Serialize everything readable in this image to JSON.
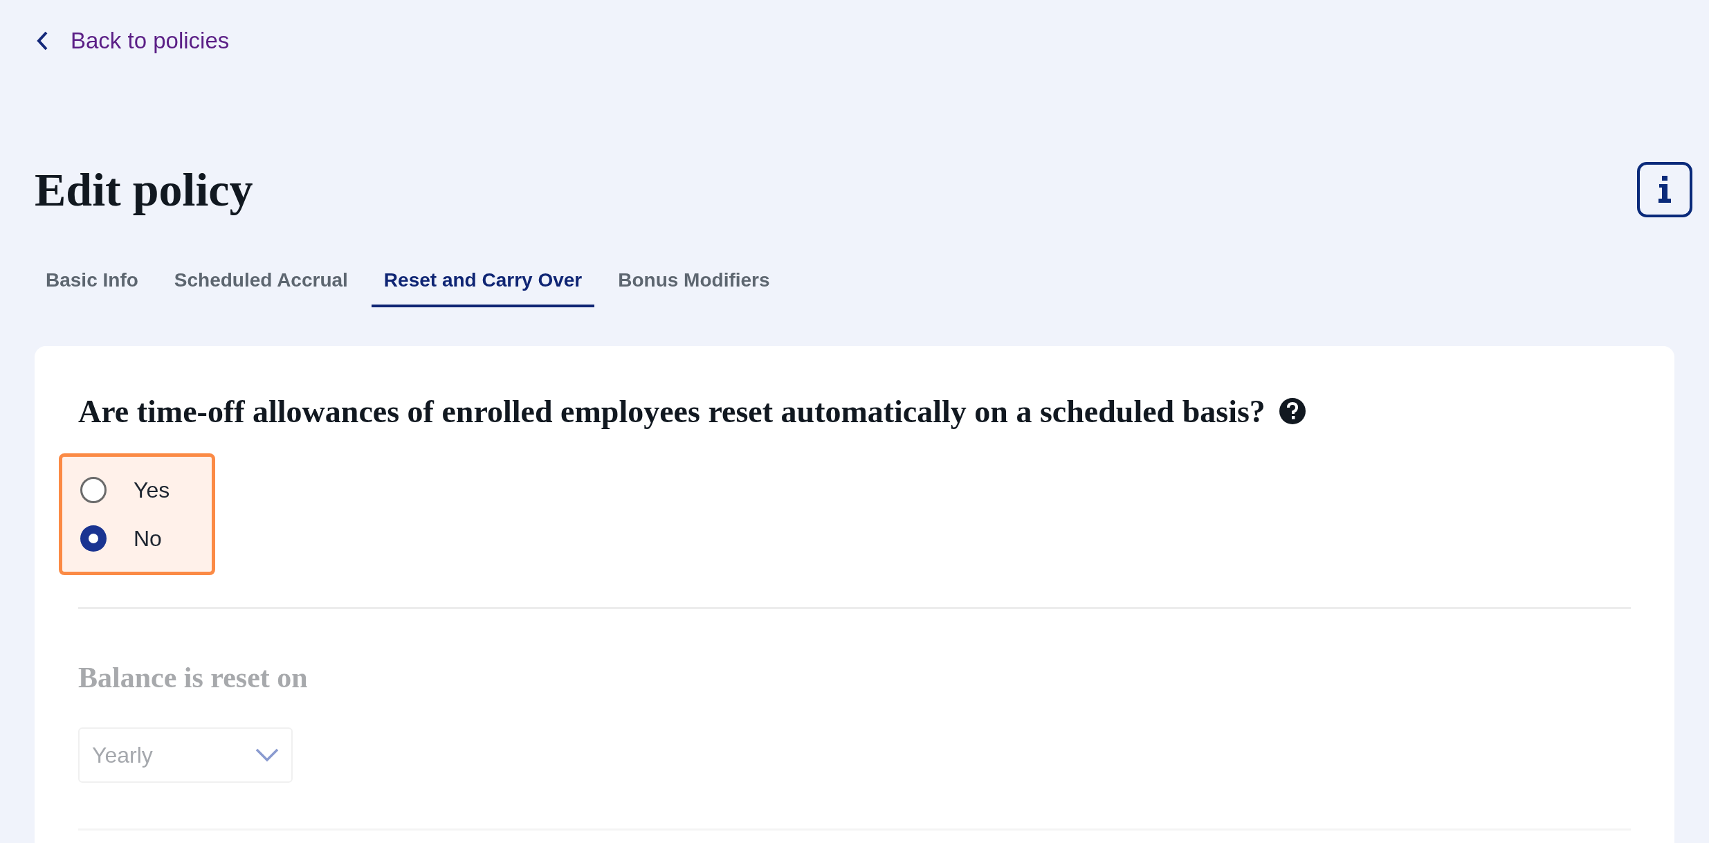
{
  "back_link": {
    "label": "Back to policies"
  },
  "page_title": "Edit policy",
  "tabs": [
    {
      "label": "Basic Info",
      "selected": false
    },
    {
      "label": "Scheduled Accrual",
      "selected": false
    },
    {
      "label": "Reset and Carry Over",
      "selected": true
    },
    {
      "label": "Bonus Modifiers",
      "selected": false
    }
  ],
  "reset_question": {
    "label": "Are time-off allowances of enrolled employees reset automatically on a scheduled basis?",
    "highlighted": true,
    "options": [
      {
        "label": "Yes",
        "selected": false
      },
      {
        "label": "No",
        "selected": true
      }
    ]
  },
  "reset_on": {
    "label": "Balance is reset on",
    "disabled": true,
    "value": "Yearly"
  }
}
